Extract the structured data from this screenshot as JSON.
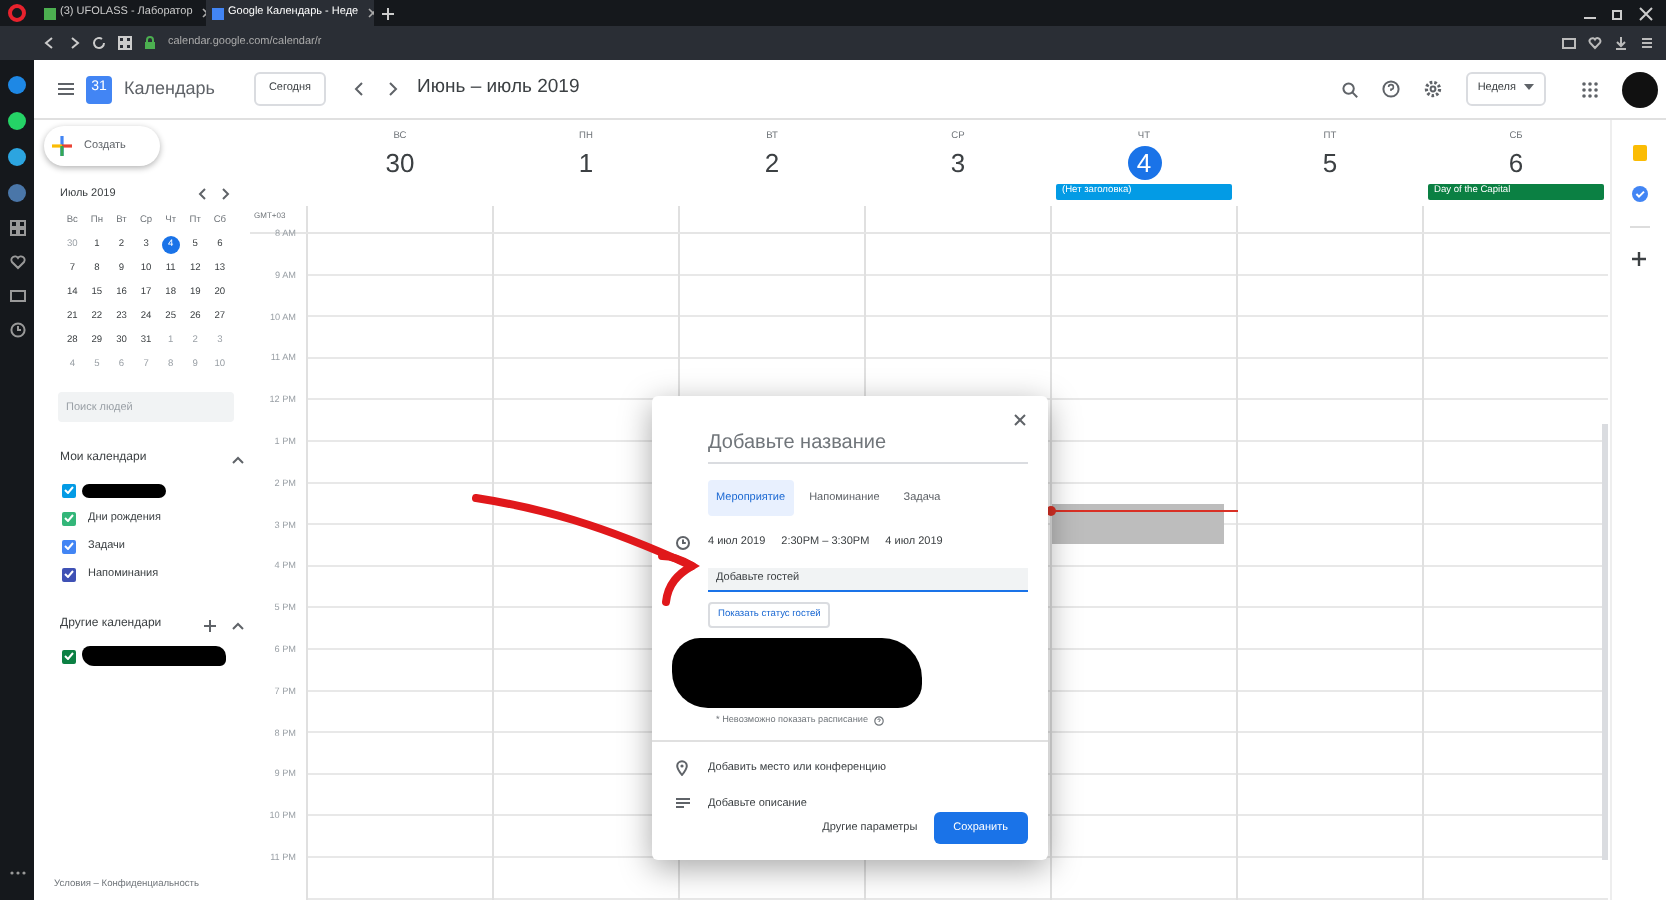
{
  "browser": {
    "tabs": [
      {
        "title": "(3) UFOLASS - Лаборатор",
        "selected": false
      },
      {
        "title": "Google Календарь - Неде",
        "selected": true
      }
    ],
    "url": "calendar.google.com/calendar/r"
  },
  "header": {
    "logo_text": "31",
    "app_name": "Календарь",
    "today_button": "Сегодня",
    "date_range": "Июнь – июль 2019",
    "view_button": "Неделя"
  },
  "sidebar": {
    "create_button": "Создать",
    "mini_calendar": {
      "title": "Июль 2019",
      "weekdays": [
        "Вс",
        "Пн",
        "Вт",
        "Ср",
        "Чт",
        "Пт",
        "Сб"
      ],
      "weeks": [
        [
          {
            "day": "30",
            "selected": false,
            "other_month": true
          },
          {
            "day": "1",
            "selected": false,
            "other_month": false
          },
          {
            "day": "2",
            "selected": false,
            "other_month": false
          },
          {
            "day": "3",
            "selected": false,
            "other_month": false
          },
          {
            "day": "4",
            "selected": true,
            "other_month": false
          },
          {
            "day": "5",
            "selected": false,
            "other_month": false
          },
          {
            "day": "6",
            "selected": false,
            "other_month": false
          }
        ],
        [
          {
            "day": "7",
            "selected": false,
            "other_month": false
          },
          {
            "day": "8",
            "selected": false,
            "other_month": false
          },
          {
            "day": "9",
            "selected": false,
            "other_month": false
          },
          {
            "day": "10",
            "selected": false,
            "other_month": false
          },
          {
            "day": "11",
            "selected": false,
            "other_month": false
          },
          {
            "day": "12",
            "selected": false,
            "other_month": false
          },
          {
            "day": "13",
            "selected": false,
            "other_month": false
          }
        ],
        [
          {
            "day": "14",
            "selected": false,
            "other_month": false
          },
          {
            "day": "15",
            "selected": false,
            "other_month": false
          },
          {
            "day": "16",
            "selected": false,
            "other_month": false
          },
          {
            "day": "17",
            "selected": false,
            "other_month": false
          },
          {
            "day": "18",
            "selected": false,
            "other_month": false
          },
          {
            "day": "19",
            "selected": false,
            "other_month": false
          },
          {
            "day": "20",
            "selected": false,
            "other_month": false
          }
        ],
        [
          {
            "day": "21",
            "selected": false,
            "other_month": false
          },
          {
            "day": "22",
            "selected": false,
            "other_month": false
          },
          {
            "day": "23",
            "selected": false,
            "other_month": false
          },
          {
            "day": "24",
            "selected": false,
            "other_month": false
          },
          {
            "day": "25",
            "selected": false,
            "other_month": false
          },
          {
            "day": "26",
            "selected": false,
            "other_month": false
          },
          {
            "day": "27",
            "selected": false,
            "other_month": false
          }
        ],
        [
          {
            "day": "28",
            "selected": false,
            "other_month": false
          },
          {
            "day": "29",
            "selected": false,
            "other_month": false
          },
          {
            "day": "30",
            "selected": false,
            "other_month": false
          },
          {
            "day": "31",
            "selected": false,
            "other_month": false
          },
          {
            "day": "1",
            "selected": false,
            "other_month": true
          },
          {
            "day": "2",
            "selected": false,
            "other_month": true
          },
          {
            "day": "3",
            "selected": false,
            "other_month": true
          }
        ],
        [
          {
            "day": "4",
            "selected": false,
            "other_month": true
          },
          {
            "day": "5",
            "selected": false,
            "other_month": true
          },
          {
            "day": "6",
            "selected": false,
            "other_month": true
          },
          {
            "day": "7",
            "selected": false,
            "other_month": true
          },
          {
            "day": "8",
            "selected": false,
            "other_month": true
          },
          {
            "day": "9",
            "selected": false,
            "other_month": true
          },
          {
            "day": "10",
            "selected": false,
            "other_month": true
          }
        ]
      ]
    },
    "people_search": {
      "placeholder": "Поиск людей"
    },
    "my_calendars": {
      "title": "Мои календари",
      "expanded": true,
      "items": [
        {
          "kind": "redacted",
          "checked": true,
          "color": "#039be5"
        },
        {
          "kind": "calendar",
          "label": "Дни рождения",
          "checked": true,
          "color": "#33b679"
        },
        {
          "kind": "calendar",
          "label": "Задачи",
          "checked": true,
          "color": "#4285f4"
        },
        {
          "kind": "calendar",
          "label": "Напоминания",
          "checked": true,
          "color": "#3f51b5"
        }
      ]
    },
    "other_calendars": {
      "title": "Другие календари",
      "expanded": true,
      "items": [
        {
          "kind": "redacted",
          "checked": true,
          "color": "#0b8043"
        }
      ]
    },
    "footer": "Условия – Конфиденциальность"
  },
  "week": {
    "timezone": "GMT+03",
    "days": [
      {
        "weekday": "ВС",
        "date": "30",
        "today": false
      },
      {
        "weekday": "ПН",
        "date": "1",
        "today": false
      },
      {
        "weekday": "ВТ",
        "date": "2",
        "today": false
      },
      {
        "weekday": "СР",
        "date": "3",
        "today": false
      },
      {
        "weekday": "ЧТ",
        "date": "4",
        "today": true,
        "draft": true,
        "current_time": true,
        "event": {
          "title": "(Нет заголовка)",
          "color": "#039be5"
        }
      },
      {
        "weekday": "ПТ",
        "date": "5",
        "today": false
      },
      {
        "weekday": "СБ",
        "date": "6",
        "today": false,
        "event": {
          "title": "Day of the Capital",
          "color": "#0b8043"
        }
      }
    ],
    "hours": [
      "8 AM",
      "9 AM",
      "10 AM",
      "11 AM",
      "12 PM",
      "1 PM",
      "2 PM",
      "3 PM",
      "4 PM",
      "5 PM",
      "6 PM",
      "7 PM",
      "8 PM",
      "9 PM",
      "10 PM",
      "11 PM"
    ]
  },
  "dialog": {
    "title_placeholder": "Добавьте название",
    "tabs": [
      {
        "label": "Мероприятие",
        "selected": true
      },
      {
        "label": "Напоминание",
        "selected": false
      },
      {
        "label": "Задача",
        "selected": false
      }
    ],
    "date_start": "4 июл 2019",
    "time_range": "2:30PM – 3:30PM",
    "date_end": "4 июл 2019",
    "guests_placeholder": "Добавьте гостей",
    "guest_status_button": "Показать статус гостей",
    "schedule_note": "* Невозможно показать расписание",
    "location": "Добавить место или конференцию",
    "description": "Добавьте описание",
    "more_options": "Другие параметры",
    "save_button": "Сохранить"
  }
}
